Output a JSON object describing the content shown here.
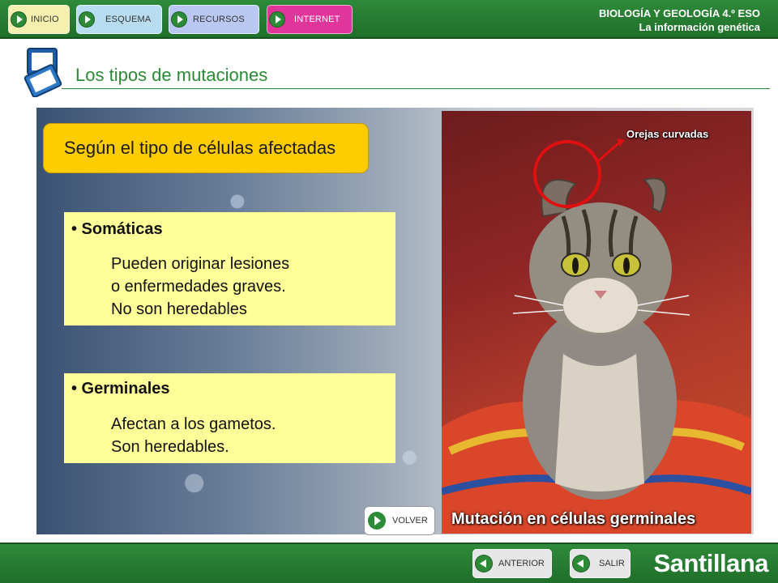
{
  "nav": {
    "inicio": "INICIO",
    "esquema": "ESQUEMA",
    "recursos": "RECURSOS",
    "internet": "INTERNET"
  },
  "header": {
    "subject": "BIOLOGÍA Y GEOLOGÍA 4.º ESO",
    "unit": "La información genética"
  },
  "section": {
    "title": "Los tipos de mutaciones"
  },
  "content": {
    "heading": "Según el tipo de células afectadas",
    "somaticas": {
      "title": "• Somáticas",
      "line1": "Pueden originar lesiones",
      "line2": "o enfermedades graves.",
      "line3": "No son heredables"
    },
    "germinales": {
      "title": "• Germinales",
      "line1": "Afectan a los gametos.",
      "line2": "Son heredables."
    }
  },
  "photo": {
    "ear_label": "Orejas curvadas",
    "caption": "Mutación en células germinales"
  },
  "volver": "VOLVER",
  "footer": {
    "anterior": "ANTERIOR",
    "salir": "SALIR",
    "brand": "Santillana"
  },
  "colors": {
    "brand_green": "#2a8a35",
    "heading_yellow": "#ffcc00",
    "box_yellow": "#ffff99",
    "nav_inicio": "#f5f0b0",
    "nav_esquema": "#b8dcf0",
    "nav_recursos": "#b8c8f0",
    "nav_internet": "#e0359a"
  }
}
